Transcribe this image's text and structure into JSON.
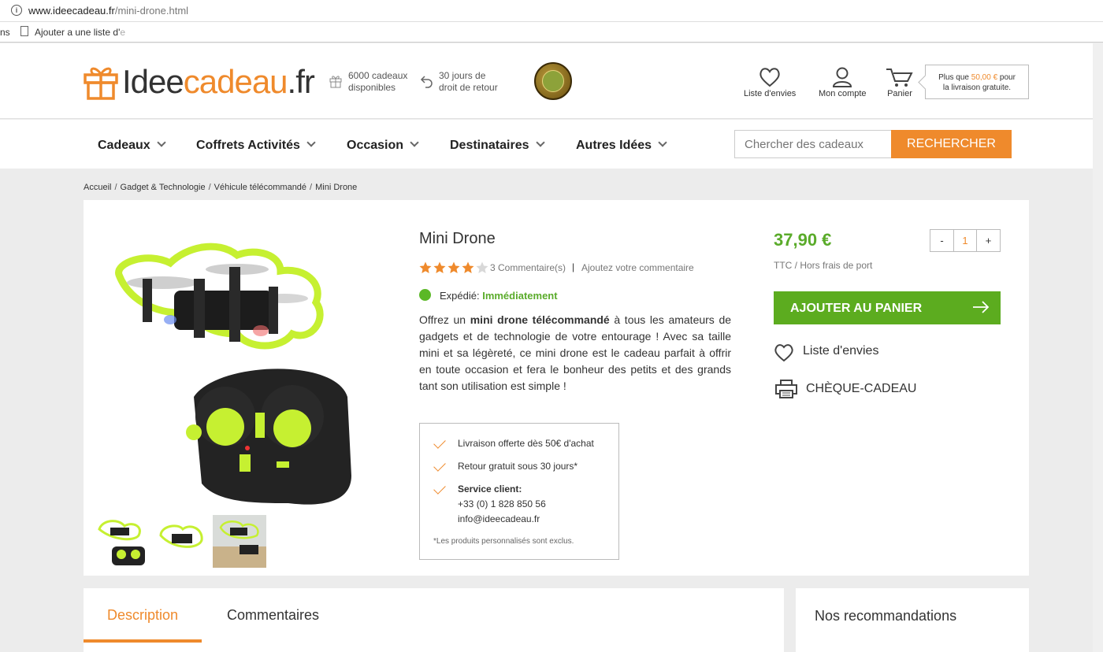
{
  "browser": {
    "url_domain": "www.ideecadeau.fr",
    "url_path": "/mini-drone.html",
    "bookmark_apps": "ns",
    "bookmark_item": "Ajouter a une liste d'",
    "bookmark_item_fade": "e"
  },
  "header": {
    "logo_part1": "Idee",
    "logo_part2": "cadeau",
    "logo_part3": ".fr",
    "usp1_line1": "6000 cadeaux",
    "usp1_line2": "disponibles",
    "usp2_line1": "30 jours de",
    "usp2_line2": "droit de retour",
    "wishlist_label": "Liste d'envies",
    "account_label": "Mon compte",
    "cart_label": "Panier",
    "promo_prefix": "Plus que ",
    "promo_amount": "50,00 €",
    "promo_suffix": " pour",
    "promo_line2": "la livraison gratuite."
  },
  "nav": {
    "items": [
      "Cadeaux",
      "Coffrets Activités",
      "Occasion",
      "Destinataires",
      "Autres Idées"
    ],
    "search_placeholder": "Chercher des cadeaux",
    "search_button": "RECHERCHER"
  },
  "breadcrumb": [
    "Accueil",
    "Gadget & Technologie",
    "Véhicule télécommandé",
    "Mini Drone"
  ],
  "product": {
    "title": "Mini Drone",
    "rating": 4,
    "rating_max": 5,
    "comments_count": "3 Commentaire(s)",
    "add_comment": "Ajoutez votre commentaire",
    "shipping_label": "Expédié: ",
    "shipping_value": "Immédiatement",
    "desc_1": "Offrez un ",
    "desc_bold": "mini drone télécommandé",
    "desc_2": " à tous les amateurs de gadgets et de technologie de votre entourage ! Avec sa taille mini et sa légèreté, ce mini drone est le cadeau parfait à offrir en toute occasion et fera le bonheur des petits et des grands tant son utilisation est simple !",
    "price": "37,90 €",
    "price_note": "TTC / Hors frais de port",
    "qty_minus": "-",
    "qty_value": "1",
    "qty_plus": "+",
    "add_to_cart": "AJOUTER AU PANIER",
    "wishlist": "Liste d'envies",
    "gift_check": "CHÈQUE-CADEAU"
  },
  "services": {
    "delivery": "Livraison offerte dès 50€ d'achat",
    "returns": "Retour gratuit sous 30 jours*",
    "support_title": "Service client:",
    "support_phone": "+33 (0) 1 828 850 56",
    "support_email": "info@ideecadeau.fr",
    "note": "*Les produits personnalisés sont exclus."
  },
  "tabs": {
    "description": "Description",
    "comments": "Commentaires",
    "recommendations": "Nos recommandations"
  },
  "colors": {
    "accent_orange": "#ef8a2c",
    "price_green": "#5aab2a",
    "cart_green": "#5cac1f",
    "drone_lime": "#c6f031"
  }
}
